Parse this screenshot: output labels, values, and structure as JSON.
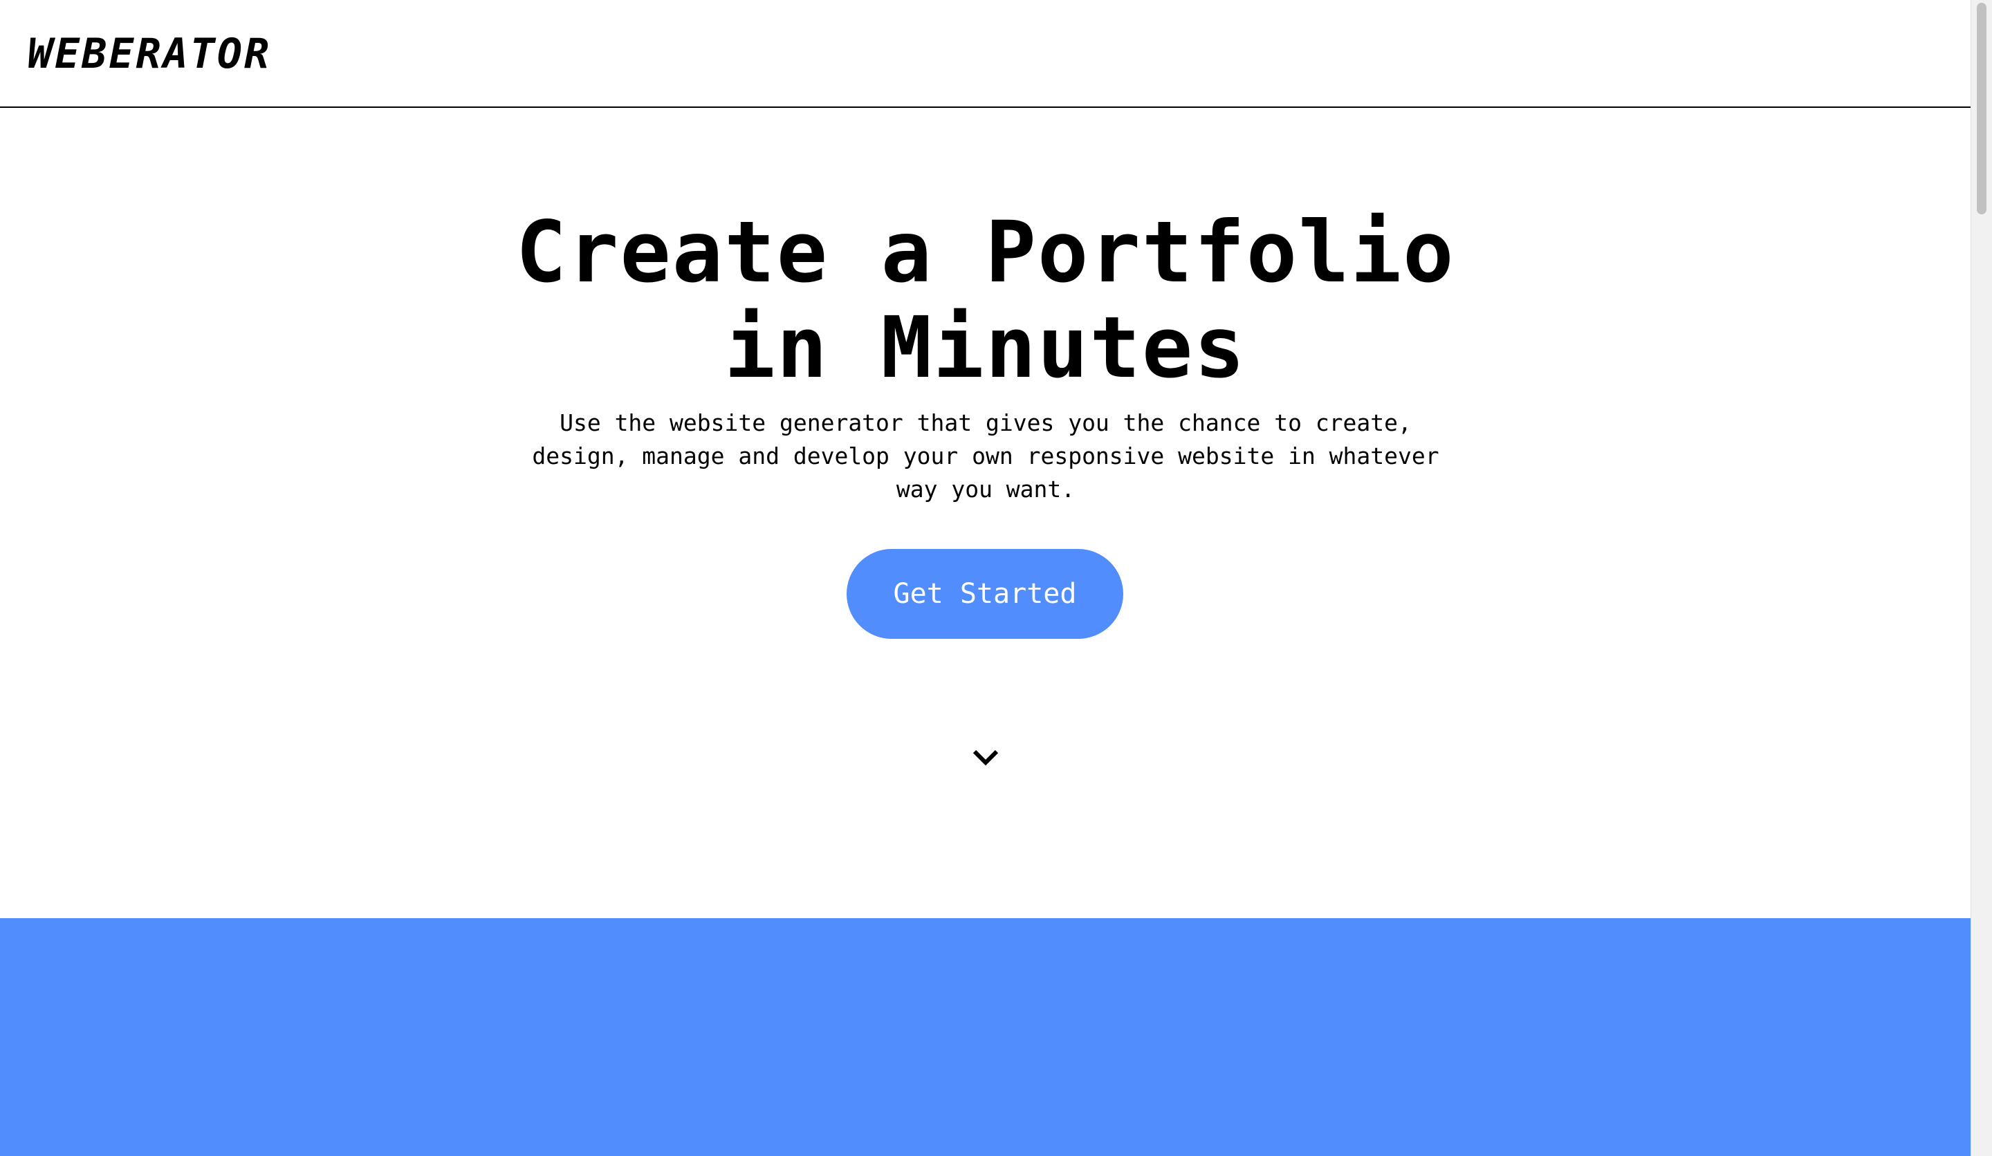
{
  "navbar": {
    "logo": "WEBERATOR"
  },
  "hero": {
    "title_line1": "Create a Portfolio",
    "title_line2": "in Minutes",
    "subtitle": "Use the website generator that gives you the chance to create, design, manage and develop your own responsive website in whatever way you want.",
    "cta_label": "Get Started",
    "scroll_icon": "chevron-down-icon"
  },
  "colors": {
    "accent": "#528dfd",
    "text": "#000000",
    "background": "#ffffff"
  }
}
